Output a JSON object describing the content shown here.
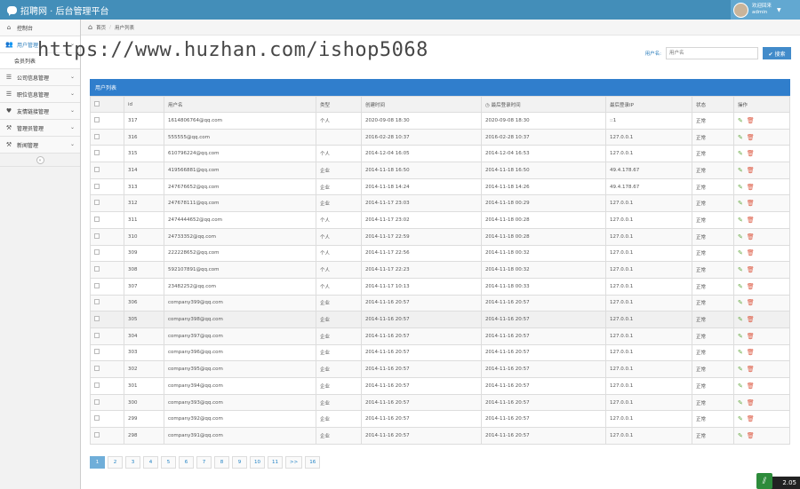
{
  "app": {
    "title": "招聘网 · 后台管理平台"
  },
  "user": {
    "welcome": "欢迎回来",
    "name": "admin"
  },
  "sidebar": {
    "items": [
      {
        "label": "控制台",
        "icon": "home-icon"
      },
      {
        "label": "用户管理",
        "icon": "users-icon"
      },
      {
        "label": "公司信息管理",
        "icon": "list-icon"
      },
      {
        "label": "职位信息管理",
        "icon": "list-icon"
      },
      {
        "label": "友情链接管理",
        "icon": "heart-icon"
      },
      {
        "label": "管理员管理",
        "icon": "gavel-icon"
      },
      {
        "label": "新闻管理",
        "icon": "gavel-icon"
      }
    ],
    "sub_item": "会员列表"
  },
  "breadcrumb": {
    "home": "首页",
    "current": "用户列表"
  },
  "watermark": "https://www.huzhan.com/ishop5068",
  "search": {
    "label": "用户名:",
    "placeholder": "用户名",
    "button": "搜索"
  },
  "table": {
    "title": "用户列表",
    "headers": [
      "",
      "id",
      "用户名",
      "类型",
      "创建时间",
      "最后登录时间",
      "最后登录IP",
      "状态",
      "操作"
    ],
    "rows": [
      [
        "317",
        "1614806764@qq.com",
        "个人",
        "2020-09-08 18:30",
        "2020-09-08 18:30",
        "::1",
        "正常"
      ],
      [
        "316",
        "555555@qq.com",
        "",
        "2016-02-28 10:37",
        "2016-02-28 10:37",
        "127.0.0.1",
        "正常"
      ],
      [
        "315",
        "610796224@qq.com",
        "个人",
        "2014-12-04 16:05",
        "2014-12-04 16:53",
        "127.0.0.1",
        "正常"
      ],
      [
        "314",
        "419566881@qq.com",
        "企业",
        "2014-11-18 16:50",
        "2014-11-18 16:50",
        "49.4.178.67",
        "正常"
      ],
      [
        "313",
        "247676652@qq.com",
        "企业",
        "2014-11-18 14:24",
        "2014-11-18 14:26",
        "49.4.178.67",
        "正常"
      ],
      [
        "312",
        "247678111@qq.com",
        "企业",
        "2014-11-17 23:03",
        "2014-11-18 00:29",
        "127.0.0.1",
        "正常"
      ],
      [
        "311",
        "2474444652@qq.com",
        "个人",
        "2014-11-17 23:02",
        "2014-11-18 00:28",
        "127.0.0.1",
        "正常"
      ],
      [
        "310",
        "24733352@qq.com",
        "个人",
        "2014-11-17 22:59",
        "2014-11-18 00:28",
        "127.0.0.1",
        "正常"
      ],
      [
        "309",
        "222228652@qq.com",
        "个人",
        "2014-11-17 22:56",
        "2014-11-18 00:32",
        "127.0.0.1",
        "正常"
      ],
      [
        "308",
        "592107891@qq.com",
        "个人",
        "2014-11-17 22:23",
        "2014-11-18 00:32",
        "127.0.0.1",
        "正常"
      ],
      [
        "307",
        "23482252@qq.com",
        "个人",
        "2014-11-17 10:13",
        "2014-11-18 00:33",
        "127.0.0.1",
        "正常"
      ],
      [
        "306",
        "company399@qq.com",
        "企业",
        "2014-11-16 20:57",
        "2014-11-16 20:57",
        "127.0.0.1",
        "正常"
      ],
      [
        "305",
        "company398@qq.com",
        "企业",
        "2014-11-16 20:57",
        "2014-11-16 20:57",
        "127.0.0.1",
        "正常"
      ],
      [
        "304",
        "company397@qq.com",
        "企业",
        "2014-11-16 20:57",
        "2014-11-16 20:57",
        "127.0.0.1",
        "正常"
      ],
      [
        "303",
        "company396@qq.com",
        "企业",
        "2014-11-16 20:57",
        "2014-11-16 20:57",
        "127.0.0.1",
        "正常"
      ],
      [
        "302",
        "company395@qq.com",
        "企业",
        "2014-11-16 20:57",
        "2014-11-16 20:57",
        "127.0.0.1",
        "正常"
      ],
      [
        "301",
        "company394@qq.com",
        "企业",
        "2014-11-16 20:57",
        "2014-11-16 20:57",
        "127.0.0.1",
        "正常"
      ],
      [
        "300",
        "company393@qq.com",
        "企业",
        "2014-11-16 20:57",
        "2014-11-16 20:57",
        "127.0.0.1",
        "正常"
      ],
      [
        "299",
        "company392@qq.com",
        "企业",
        "2014-11-16 20:57",
        "2014-11-16 20:57",
        "127.0.0.1",
        "正常"
      ],
      [
        "298",
        "company391@qq.com",
        "企业",
        "2014-11-16 20:57",
        "2014-11-16 20:57",
        "127.0.0.1",
        "正常"
      ]
    ]
  },
  "pagination": [
    "1",
    "2",
    "3",
    "4",
    "5",
    "6",
    "7",
    "8",
    "9",
    "10",
    "11",
    ">>",
    "16"
  ],
  "badge": {
    "value": "2.05"
  },
  "colors": {
    "topbar": "#438eb9",
    "table_header": "#307ecc",
    "primary_button": "#428bca"
  }
}
